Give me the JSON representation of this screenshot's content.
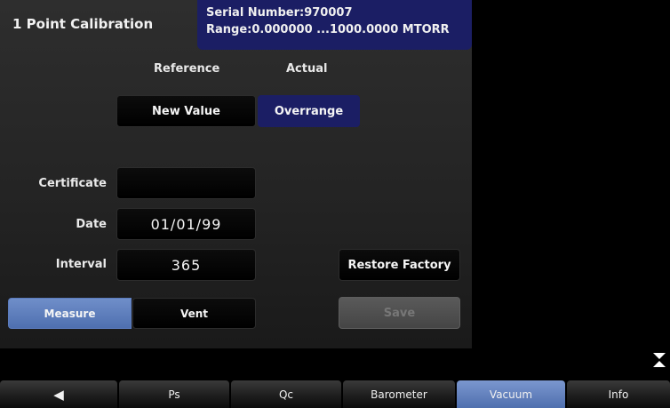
{
  "header": {
    "title": "1 Point Calibration",
    "serial": "Serial Number:970007",
    "range": "Range:0.000000 ...1000.0000 MTORR"
  },
  "columns": {
    "reference": "Reference",
    "actual": "Actual"
  },
  "buttons": {
    "new_value": "New Value",
    "overrange": "Overrange",
    "restore_factory": "Restore Factory",
    "measure": "Measure",
    "vent": "Vent",
    "save": "Save"
  },
  "fields": {
    "certificate_label": "Certificate",
    "certificate_value": "",
    "date_label": "Date",
    "date_value": "01/01/99",
    "interval_label": "Interval",
    "interval_value": "365"
  },
  "tabs": [
    {
      "label": "◀",
      "icon": "back-arrow-icon"
    },
    {
      "label": "Ps"
    },
    {
      "label": "Qc"
    },
    {
      "label": "Barometer"
    },
    {
      "label": "Vacuum",
      "active": true
    },
    {
      "label": "Info"
    }
  ],
  "colors": {
    "accent_navy": "#1b1e64",
    "active_blue": "#5b7bbd",
    "panel_gray": "#2a2a2a"
  },
  "icons": {
    "collapse": "collapse-arrows-icon"
  }
}
